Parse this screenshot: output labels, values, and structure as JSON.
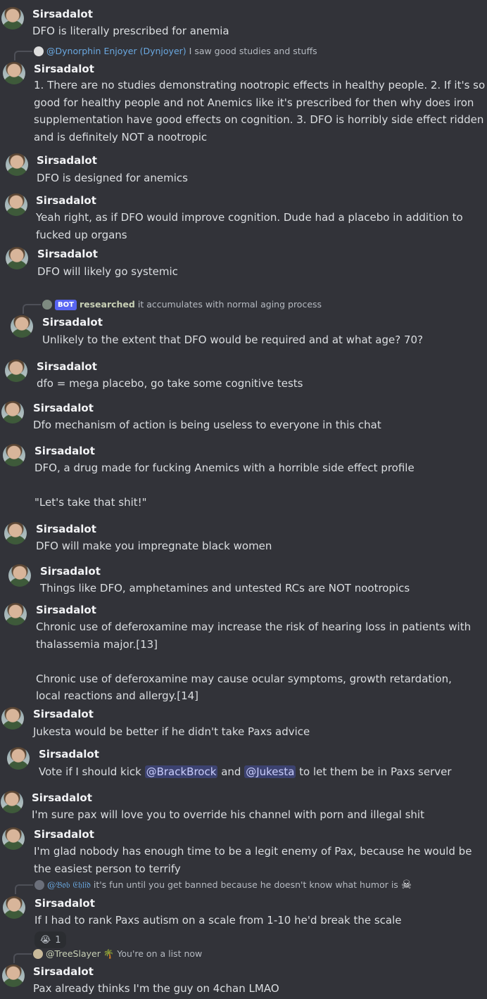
{
  "username": "Sirsadalot",
  "messages": [
    {
      "text": "DFO is literally prescribed for anemia"
    },
    {
      "reply": {
        "name": "@Dynorphin Enjoyer (Dynjoyer)",
        "text": "I saw good studies and stuffs"
      },
      "text": "1. There are no studies demonstrating nootropic effects in healthy people. 2. If it's so good for healthy people and not Anemics like it's prescribed for then why does iron supplementation have good effects on cognition. 3. DFO is horribly side effect ridden and is definitely NOT a nootropic"
    },
    {
      "text": "DFO is designed for anemics"
    },
    {
      "text": "Yeah right, as if DFO would improve cognition. Dude had a placebo in addition to fucked up organs"
    },
    {
      "text": "DFO will likely go systemic"
    },
    {
      "reply": {
        "bot": "BOT",
        "name": "researched",
        "text": "it accumulates with normal aging process"
      },
      "text": "Unlikely to the extent that DFO would be required and at what age? 70?"
    },
    {
      "text": "dfo = mega placebo, go take some cognitive tests"
    },
    {
      "text": "Dfo mechanism of action is being useless to everyone in this chat"
    },
    {
      "text": "DFO, a drug made for fucking Anemics with a horrible side effect profile\n\n\"Let's take that shit!\""
    },
    {
      "text": "DFO will make you impregnate black women"
    },
    {
      "text": "Things like DFO, amphetamines and untested RCs are NOT nootropics"
    },
    {
      "text": "Chronic use of deferoxamine may increase the risk of hearing loss in patients with thalassemia major.[13]\n\nChronic use of deferoxamine may cause ocular symptoms, growth retardation, local reactions and allergy.[14]"
    },
    {
      "text": "Jukesta would be better if he didn't take Paxs advice"
    },
    {
      "text_pre": "Vote if I should kick ",
      "mention1": "@BrackBrock",
      "text_mid": " and ",
      "mention2": "@Jukesta",
      "text_post": " to let them be in Paxs server"
    },
    {
      "text": "I'm sure pax will love you to override his channel with porn and illegal shit"
    },
    {
      "text": "I'm glad nobody has enough time to be a legit enemy of Pax, because he would be the easiest person to terrify"
    },
    {
      "reply": {
        "name": "@𝔅𝔬𝔟 𝔈𝔥𝔩𝔦𝔡",
        "text": "it's fun until you get banned because he doesn't know what humor is",
        "emoji": "☠"
      },
      "text": "If I had to rank Paxs autism on a scale from 1-10 he'd break the scale",
      "reaction": {
        "emoji": "😭",
        "count": "1"
      }
    },
    {
      "reply": {
        "name": "@TreeSlayer",
        "emoji": "🌴",
        "text": "You're on a list now"
      },
      "text": "Pax already thinks I'm the guy on 4chan LMAO"
    }
  ]
}
